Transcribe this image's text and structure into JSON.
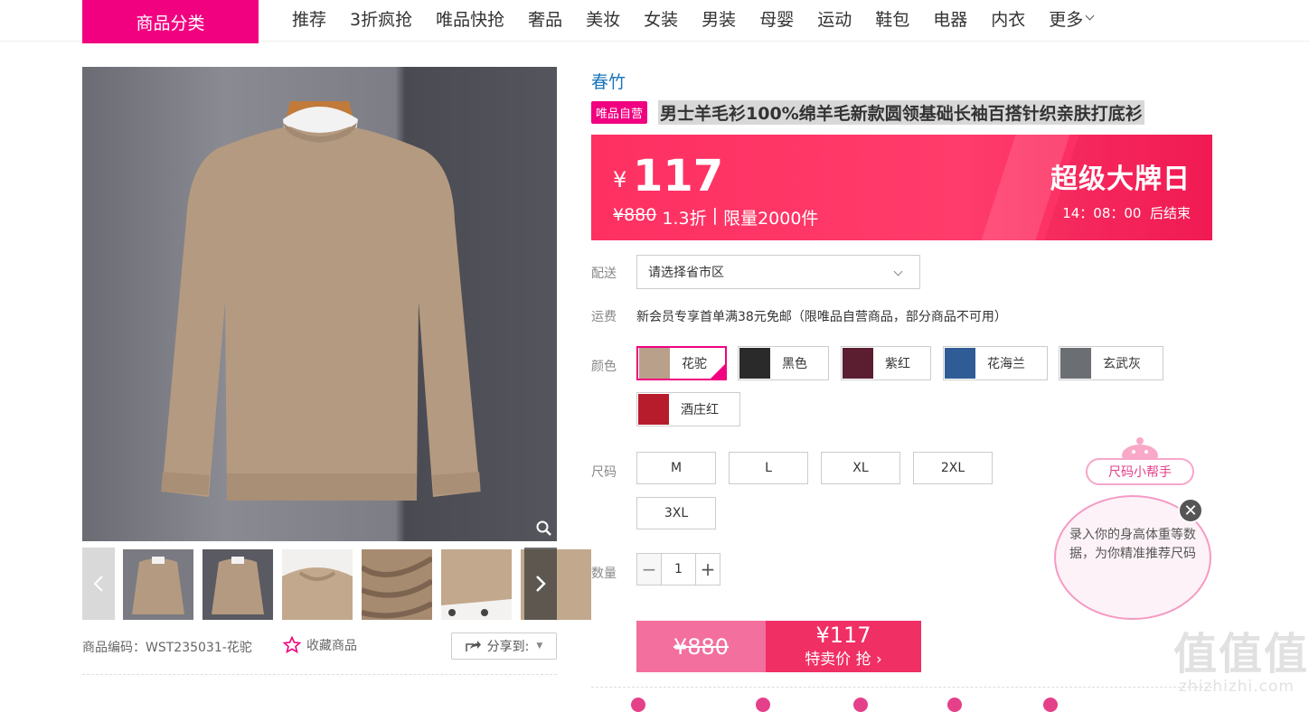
{
  "nav": {
    "category_button": "商品分类",
    "items": [
      "推荐",
      "3折疯抢",
      "唯品快抢",
      "奢品",
      "美妆",
      "女装",
      "男装",
      "母婴",
      "运动",
      "鞋包",
      "电器",
      "内衣"
    ],
    "more": "更多"
  },
  "product": {
    "brand": "春竹",
    "tag": "唯品自营",
    "title": "男士羊毛衫100%绵羊毛新款圆领基础长袖百搭针织亲肤打底衫",
    "code_label": "商品编码：WST235031-花驼",
    "favorite_label": "收藏商品",
    "share_label": "分享到:"
  },
  "price": {
    "currency": "¥",
    "current": "117",
    "original": "¥880",
    "discount": "1.3折",
    "separator": " | ",
    "limit": "限量2000件",
    "event": "超级大牌日",
    "countdown": "14：08：00  后结束"
  },
  "delivery": {
    "label": "配送",
    "placeholder": "请选择省市区"
  },
  "freight": {
    "label": "运费",
    "text": "新会员专享首单满38元免邮（限唯品自营商品，部分商品不可用）"
  },
  "colors": {
    "label": "颜色",
    "options": [
      "花驼",
      "黑色",
      "紫红",
      "花海兰",
      "玄武灰",
      "酒庄红"
    ],
    "selected": "花驼",
    "swatch_colors": [
      "#b8a08a",
      "#2a2a2a",
      "#5a1e30",
      "#2f5c95",
      "#6b6e72",
      "#b71c2c"
    ]
  },
  "sizes": {
    "label": "尺码",
    "options": [
      "M",
      "L",
      "XL",
      "2XL",
      "3XL"
    ]
  },
  "quantity": {
    "label": "数量",
    "value": "1",
    "minus": "−",
    "plus": "+"
  },
  "buy": {
    "original": "¥880",
    "price": "¥117",
    "action": "特卖价 抢"
  },
  "size_helper": {
    "title": "尺码小帮手",
    "text": "录入你的身高体重等数据，为你精准推荐尺码",
    "close": "✕"
  },
  "watermark": {
    "big": "值值值",
    "small": "zhizhizhi.com"
  },
  "theme": {
    "accent": "#f10180",
    "price_red": "#fe3062",
    "link_blue": "#1a75bb"
  }
}
